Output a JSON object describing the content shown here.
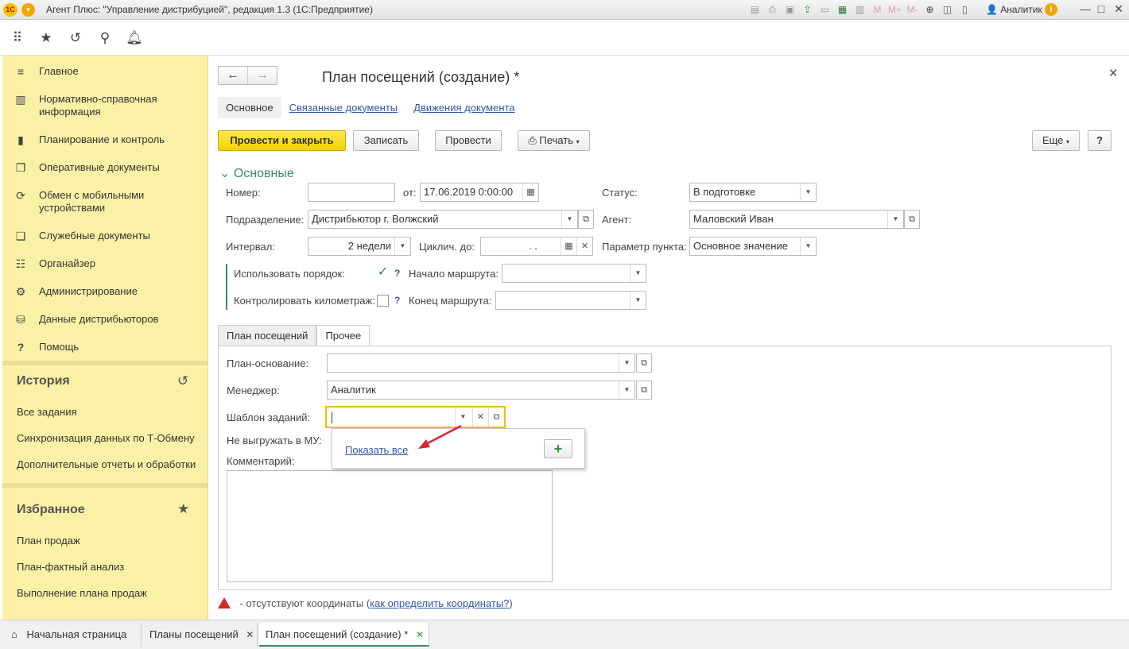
{
  "titlebar": {
    "logo": "1С",
    "title": "Агент Плюс: \"Управление дистрибуцией\", редакция 1.3  (1С:Предприятие)",
    "icons": [
      "save-icon",
      "print-icon",
      "preview-icon",
      "upload-icon",
      "disk-icon",
      "calc-icon",
      "calendar-icon"
    ],
    "m": "M",
    "mplus": "M+",
    "mminus": "M-",
    "user": "Аналитик",
    "info": "i",
    "minimize": "—",
    "maximize": "□",
    "close": "✕"
  },
  "topbar": {
    "icons": [
      "apps-grid-icon",
      "star-icon",
      "history-icon",
      "search-icon",
      "bell-icon"
    ]
  },
  "sidebar": {
    "items": [
      {
        "label": "Главное",
        "icon": "menu-icon"
      },
      {
        "label": "Нормативно-справочная информация",
        "icon": "reference-icon"
      },
      {
        "label": "Планирование и контроль",
        "icon": "chart-icon"
      },
      {
        "label": "Оперативные документы",
        "icon": "documents-icon"
      },
      {
        "label": "Обмен с мобильными устройствами",
        "icon": "sync-icon"
      },
      {
        "label": "Служебные документы",
        "icon": "service-docs-icon"
      },
      {
        "label": "Органайзер",
        "icon": "organizer-icon"
      },
      {
        "label": "Администрирование",
        "icon": "gear-icon"
      },
      {
        "label": "Данные дистрибьюторов",
        "icon": "distributors-icon"
      },
      {
        "label": "Помощь",
        "icon": "help-icon"
      }
    ],
    "history_title": "История",
    "history_links": [
      "Все задания",
      "Синхронизация данных по Т-Обмену",
      "Дополнительные отчеты и обработки"
    ],
    "favorites_title": "Избранное",
    "favorites_links": [
      "План продаж",
      "План-фактный анализ",
      "Выполнение плана продаж"
    ]
  },
  "form": {
    "title": "План посещений  (создание) *",
    "subtabs": [
      "Основное",
      "Связанные документы",
      "Движения документа"
    ],
    "buttons": {
      "post_close": "Провести и закрыть",
      "save": "Записать",
      "post": "Провести",
      "print": "Печать",
      "more": "Еще",
      "help": "?"
    },
    "group_title": "Основные",
    "fields": {
      "number_label": "Номер:",
      "number_value": "",
      "from_label": "от:",
      "date_value": "17.06.2019  0:00:00",
      "status_label": "Статус:",
      "status_value": "В подготовке",
      "division_label": "Подразделение:",
      "division_value": "Дистрибьютор г. Волжский",
      "agent_label": "Агент:",
      "agent_value": "Маловский Иван",
      "interval_label": "Интервал:",
      "interval_value": "2 недели",
      "cycle_label": "Циклич. до:",
      "cycle_value": ".   .",
      "point_param_label": "Параметр пункта:",
      "point_param_value": "Основное значение",
      "use_order_label": "Использовать порядок:",
      "use_order_checked": "✓",
      "route_start_label": "Начало маршрута:",
      "route_start_value": "",
      "control_km_label": "Контролировать километраж:",
      "route_end_label": "Конец маршрута:",
      "route_end_value": "",
      "help_mark": "?"
    },
    "tabs": [
      "План посещений",
      "Прочее"
    ],
    "other": {
      "plan_basis_label": "План-основание:",
      "plan_basis_value": "",
      "manager_label": "Менеджер:",
      "manager_value": "Аналитик",
      "task_template_label": "Шаблон заданий:",
      "task_template_value": "",
      "no_upload_label": "Не выгружать в МУ:",
      "comment_label": "Комментарий:"
    },
    "popup": {
      "show_all": "Показать все",
      "add": "+"
    },
    "warning": {
      "text": " - отсутствуют координаты (",
      "link": "как определить координаты?",
      "tail": ")"
    }
  },
  "bottombar": {
    "home": "Начальная страница",
    "tabs": [
      "Планы посещений",
      "План посещений  (создание) *"
    ],
    "close": "✕"
  },
  "colors": {
    "sidebar_bg": "#fbf1a6",
    "primary_button": "#f5d000",
    "group_green": "#3a8e5e",
    "link_blue": "#3357a8",
    "arrow_red": "#d9272e"
  }
}
